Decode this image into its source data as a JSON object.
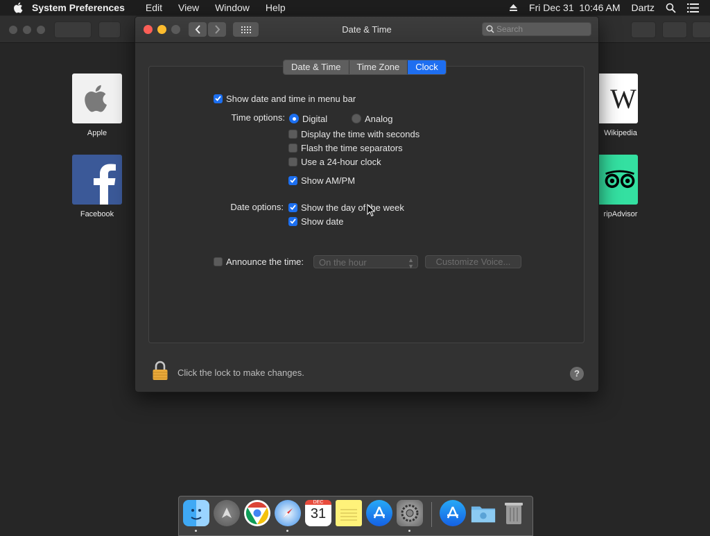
{
  "menubar": {
    "app_name": "System Preferences",
    "items": [
      "Edit",
      "View",
      "Window",
      "Help"
    ],
    "datetime": "Fri Dec 31  10:46 AM",
    "user": "Dartz"
  },
  "favorites": [
    {
      "label": "Apple"
    },
    {
      "label": "Facebook"
    },
    {
      "label": "Wikipedia"
    },
    {
      "label": "ripAdvisor"
    }
  ],
  "prefs": {
    "title": "Date & Time",
    "search_placeholder": "Search",
    "tabs": [
      {
        "label": "Date & Time",
        "selected": false
      },
      {
        "label": "Time Zone",
        "selected": false
      },
      {
        "label": "Clock",
        "selected": true
      }
    ],
    "show_in_menu_bar": {
      "label": "Show date and time in menu bar",
      "checked": true
    },
    "time_options_label": "Time options:",
    "digital": {
      "label": "Digital",
      "selected": true
    },
    "analog": {
      "label": "Analog",
      "selected": false
    },
    "display_seconds": {
      "label": "Display the time with seconds",
      "checked": false
    },
    "flash_separators": {
      "label": "Flash the time separators",
      "checked": false
    },
    "use_24_hour": {
      "label": "Use a 24-hour clock",
      "checked": false
    },
    "show_ampm": {
      "label": "Show AM/PM",
      "checked": true
    },
    "date_options_label": "Date options:",
    "show_day_of_week": {
      "label": "Show the day of the week",
      "checked": true
    },
    "show_date": {
      "label": "Show date",
      "checked": true
    },
    "announce": {
      "label": "Announce the time:",
      "checked": false
    },
    "announce_interval": "On the hour",
    "customize_voice": "Customize Voice...",
    "lock_text": "Click the lock to make changes.",
    "help": "?"
  },
  "dock": {
    "calendar_month": "DEC",
    "calendar_day": "31"
  },
  "colors": {
    "accent": "#1e6ef0",
    "window_bg": "#323232"
  }
}
